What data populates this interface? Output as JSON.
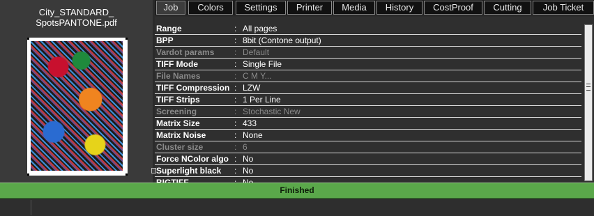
{
  "file": {
    "name_line1": "City_STANDARD_",
    "name_line2": "SpotsPANTONE.pdf"
  },
  "tabs": [
    {
      "label": "Job",
      "active": true
    },
    {
      "label": "Colors"
    },
    {
      "label": "Settings"
    },
    {
      "label": "Printer"
    },
    {
      "label": "Media"
    },
    {
      "label": "History"
    },
    {
      "label": "CostProof"
    },
    {
      "label": "Cutting"
    },
    {
      "label": "Job Ticket"
    }
  ],
  "params": {
    "separator": ":",
    "rows": [
      {
        "label": "Range",
        "value": "All pages"
      },
      {
        "label": "BPP",
        "value": "8bit (Contone output)"
      },
      {
        "label": "Vardot params",
        "value": "Default",
        "disabled": true
      },
      {
        "label": "TIFF Mode",
        "value": "Single File"
      },
      {
        "label": "File Names",
        "value": "C M Y...",
        "disabled": true
      },
      {
        "label": "TIFF Compression",
        "value": "LZW"
      },
      {
        "label": "TIFF Strips",
        "value": "1 Per Line"
      },
      {
        "label": "Screening",
        "value": "Stochastic New",
        "disabled": true
      },
      {
        "label": "Matrix Size",
        "value": "433"
      },
      {
        "label": "Matrix Noise",
        "value": "None"
      },
      {
        "label": "Cluster size",
        "value": "6",
        "disabled": true
      },
      {
        "label": "Force NColor algo",
        "value": "No"
      },
      {
        "label": "Superlight black",
        "value": "No"
      },
      {
        "label": "BIGTIFF",
        "value": "No"
      }
    ]
  },
  "status": {
    "text": "Finished",
    "color": "#5aa84a"
  }
}
